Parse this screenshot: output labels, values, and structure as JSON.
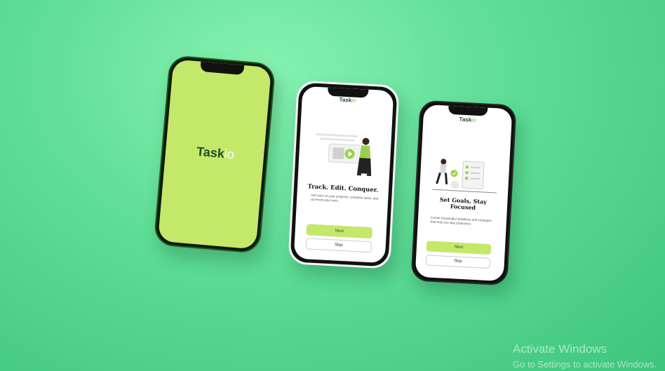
{
  "splash": {
    "logo_main": "Task",
    "logo_sub": "io"
  },
  "onboarding1": {
    "logo_main": "Task",
    "logo_sub": "io",
    "heading": "Track. Edit. Conquer.",
    "body": "Get track on your progress, complete tasks, and up-levels your work.",
    "next_label": "Next",
    "skip_label": "Skip"
  },
  "onboarding2": {
    "logo_main": "Task",
    "logo_sub": "io",
    "heading_line1": "Set Goals, Stay",
    "heading_line2": "Focused",
    "body": "Create meaningful deadlines and strategies that help you stay productive.",
    "next_label": "Next",
    "skip_label": "Skip"
  },
  "watermark": {
    "line1": "Activate Windows",
    "line2": "Go to Settings to activate Windows."
  },
  "colors": {
    "accent": "#c4e86a",
    "brand_dark": "#1e4d2b",
    "background": "#5ddc95"
  }
}
